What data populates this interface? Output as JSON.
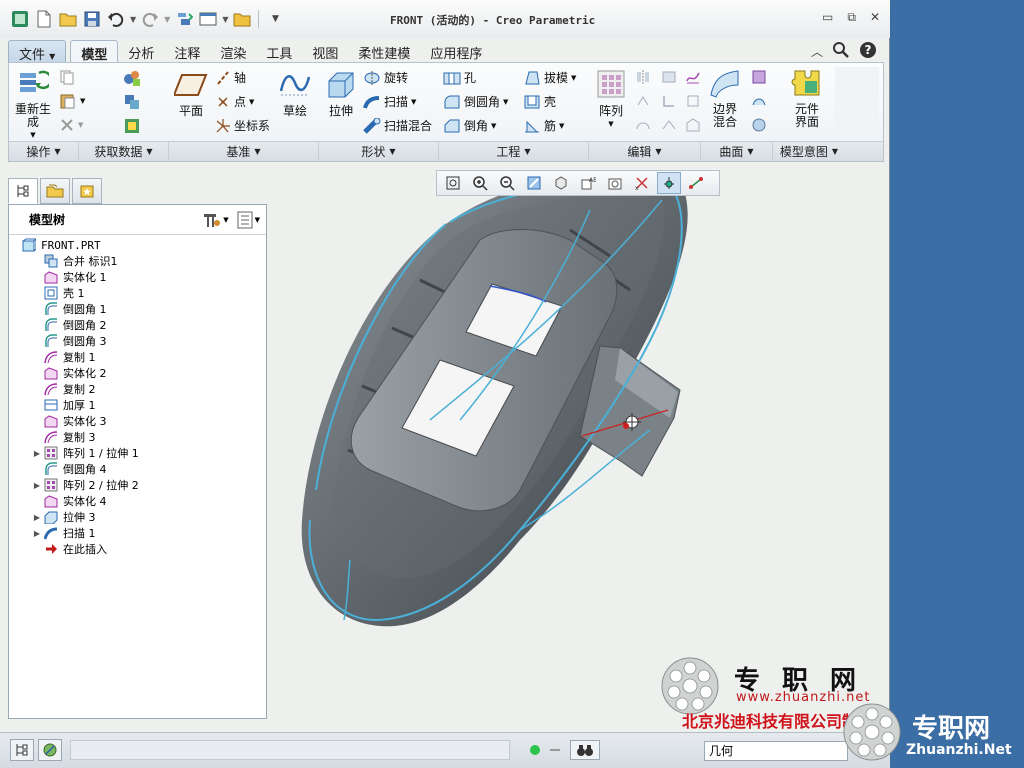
{
  "window": {
    "title": "FRONT (活动的) - Creo Parametric",
    "controls": [
      "minimize",
      "restore",
      "close"
    ]
  },
  "quick_access": [
    "new-icon",
    "open-icon",
    "save-icon",
    "undo-icon",
    "redo-icon",
    "regenerate-icon",
    "windows-icon",
    "folder-icon",
    "customize-icon"
  ],
  "ribbon": {
    "tabs": [
      "文件",
      "模型",
      "分析",
      "注释",
      "渲染",
      "工具",
      "视图",
      "柔性建模",
      "应用程序"
    ],
    "active_tab": "模型",
    "buttons": {
      "regenerate": "重新生成",
      "plane": "平面",
      "axis": "轴",
      "point": "点",
      "csys": "坐标系",
      "sketch": "草绘",
      "extrude": "拉伸",
      "revolve": "旋转",
      "sweep": "扫描",
      "swept_blend": "扫描混合",
      "hole": "孔",
      "round": "倒圆角",
      "chamfer": "倒角",
      "draft": "拔模",
      "shell": "壳",
      "rib": "筋",
      "pattern": "阵列",
      "boundary_blend": "边界混合",
      "component_interface": "元件界面"
    },
    "groups": [
      "操作",
      "获取数据",
      "基准",
      "形状",
      "工程",
      "编辑",
      "曲面",
      "模型意图"
    ]
  },
  "graphics_toolbar": [
    "refit-icon",
    "zoom-in-icon",
    "zoom-out-icon",
    "repaint-icon",
    "display-style-icon",
    "saved-views-icon",
    "view-manager-icon",
    "perspective-icon",
    "datum-display-icon",
    "spin-center-icon",
    "annotation-display-icon"
  ],
  "model_tree": {
    "header": "模型树",
    "nodes": [
      {
        "label": "FRONT.PRT",
        "icon": "part-icon",
        "level": 0,
        "expand": ""
      },
      {
        "label": "合并 标识1",
        "icon": "merge-icon",
        "level": 1,
        "expand": ""
      },
      {
        "label": "实体化 1",
        "icon": "solidify-icon",
        "level": 1,
        "expand": ""
      },
      {
        "label": "壳 1",
        "icon": "shell-icon",
        "level": 1,
        "expand": ""
      },
      {
        "label": "倒圆角 1",
        "icon": "round-icon",
        "level": 1,
        "expand": ""
      },
      {
        "label": "倒圆角 2",
        "icon": "round-icon",
        "level": 1,
        "expand": ""
      },
      {
        "label": "倒圆角 3",
        "icon": "round-icon",
        "level": 1,
        "expand": ""
      },
      {
        "label": "复制 1",
        "icon": "copy-icon",
        "level": 1,
        "expand": ""
      },
      {
        "label": "实体化 2",
        "icon": "solidify-icon",
        "level": 1,
        "expand": ""
      },
      {
        "label": "复制 2",
        "icon": "copy-icon",
        "level": 1,
        "expand": ""
      },
      {
        "label": "加厚 1",
        "icon": "thicken-icon",
        "level": 1,
        "expand": ""
      },
      {
        "label": "实体化 3",
        "icon": "solidify-icon",
        "level": 1,
        "expand": ""
      },
      {
        "label": "复制 3",
        "icon": "copy-icon",
        "level": 1,
        "expand": ""
      },
      {
        "label": "阵列 1 / 拉伸 1",
        "icon": "pattern-icon",
        "level": 1,
        "expand": "▶"
      },
      {
        "label": "倒圆角 4",
        "icon": "round-icon",
        "level": 1,
        "expand": ""
      },
      {
        "label": "阵列 2 / 拉伸 2",
        "icon": "pattern-icon",
        "level": 1,
        "expand": "▶"
      },
      {
        "label": "实体化 4",
        "icon": "solidify-icon",
        "level": 1,
        "expand": ""
      },
      {
        "label": "拉伸 3",
        "icon": "extrude-icon",
        "level": 1,
        "expand": "▶"
      },
      {
        "label": "扫描 1",
        "icon": "sweep-icon",
        "level": 1,
        "expand": "▶"
      },
      {
        "label": "在此插入",
        "icon": "insert-here-icon",
        "level": 1,
        "expand": ""
      }
    ]
  },
  "status": {
    "filter_value": "几何"
  },
  "watermark": {
    "title": "专职网",
    "url": "www.zhuanzhi.net",
    "company": "北京兆迪科技有限公司制作",
    "brand": "专职网",
    "brand_url": "Zhuanzhi.Net"
  },
  "colors": {
    "model_gray": "#6f767c",
    "edge_highlight": "#4ab0d8",
    "watermark_red": "#d0121a"
  }
}
